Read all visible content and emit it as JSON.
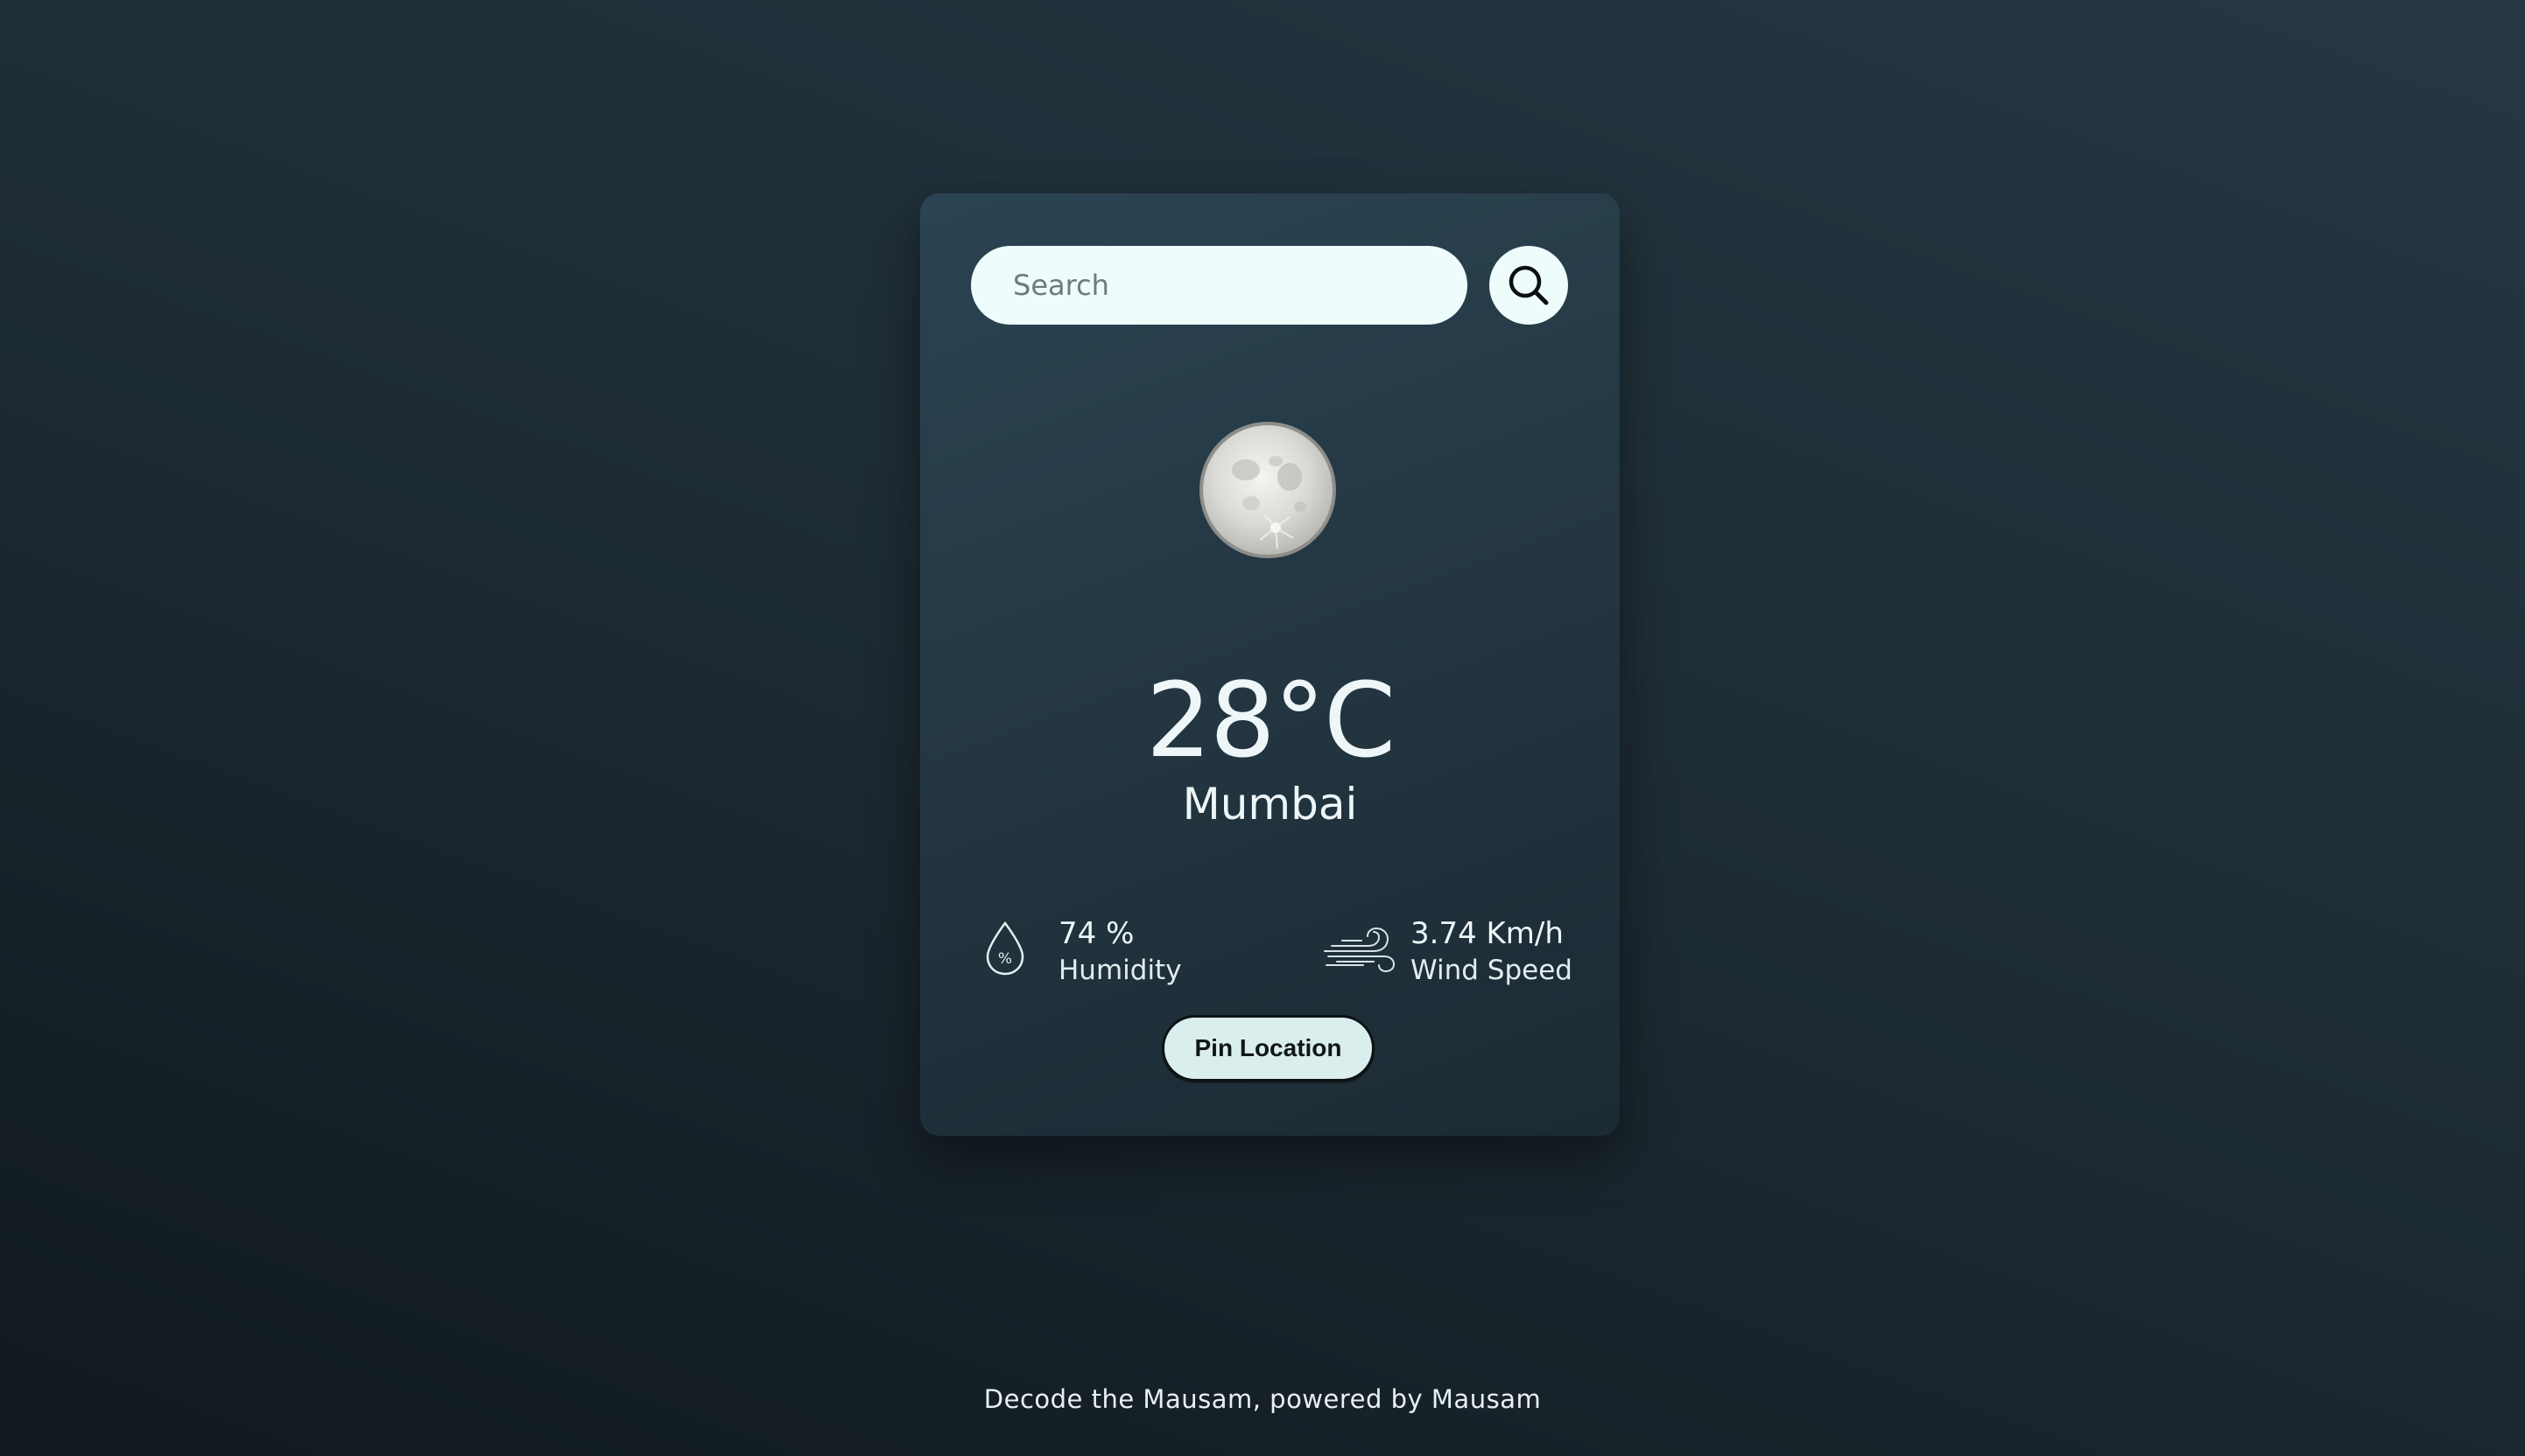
{
  "search": {
    "placeholder": "Search",
    "value": "",
    "button_icon": "search-icon"
  },
  "weather": {
    "icon": "full-moon-icon",
    "temperature": "28°C",
    "city": "Mumbai"
  },
  "stats": {
    "humidity": {
      "icon": "humidity-drop-icon",
      "value": "74 %",
      "label": "Humidity"
    },
    "wind": {
      "icon": "wind-icon",
      "value": "3.74 Km/h",
      "label": "Wind Speed"
    }
  },
  "actions": {
    "pin_location_label": "Pin Location"
  },
  "footer": {
    "text": "Decode the Mausam, powered by Mausam"
  },
  "colors": {
    "background_dark": "#10191f",
    "card": "#233641",
    "input_background": "#eefcfb",
    "button_background": "#dbeeee",
    "text": "#eef6f8"
  }
}
